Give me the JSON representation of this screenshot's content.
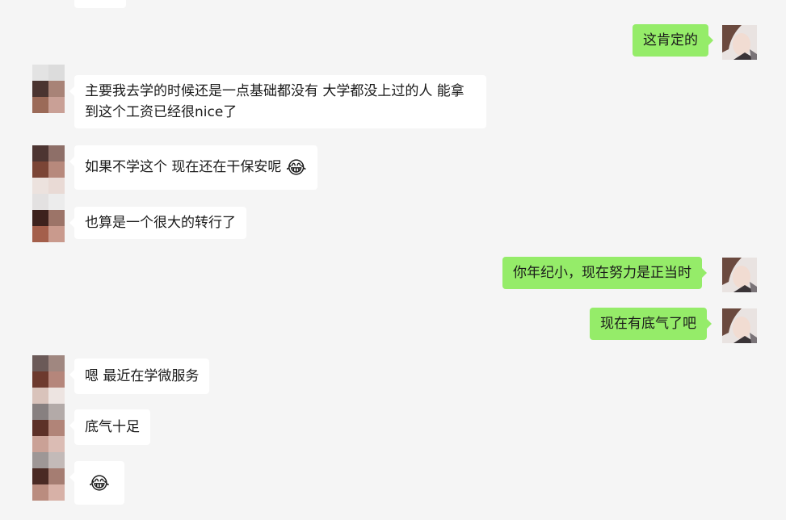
{
  "messages": [
    {
      "side": "right",
      "text": "这肯定的"
    },
    {
      "side": "left",
      "text": "主要我去学的时候还是一点基础都没有  大学都没上过的人 能拿到这个工资已经很nice了"
    },
    {
      "side": "left",
      "text": "如果不学这个 现在还在干保安呢",
      "emoji": "😂"
    },
    {
      "side": "left",
      "text": "也算是一个很大的转行了"
    },
    {
      "side": "right",
      "text": "你年纪小，现在努力是正当时"
    },
    {
      "side": "right",
      "text": "现在有底气了吧"
    },
    {
      "side": "left",
      "text": "嗯 最近在学微服务"
    },
    {
      "side": "left",
      "text": "底气十足"
    },
    {
      "side": "left",
      "text": "",
      "emoji": "😂"
    }
  ],
  "colors": {
    "background": "#f5f5f5",
    "self_bubble": "#95ec69",
    "other_bubble": "#ffffff"
  },
  "icons": {
    "contact_avatar": "pixelated-avatar",
    "self_avatar": "self-avatar-photo"
  }
}
